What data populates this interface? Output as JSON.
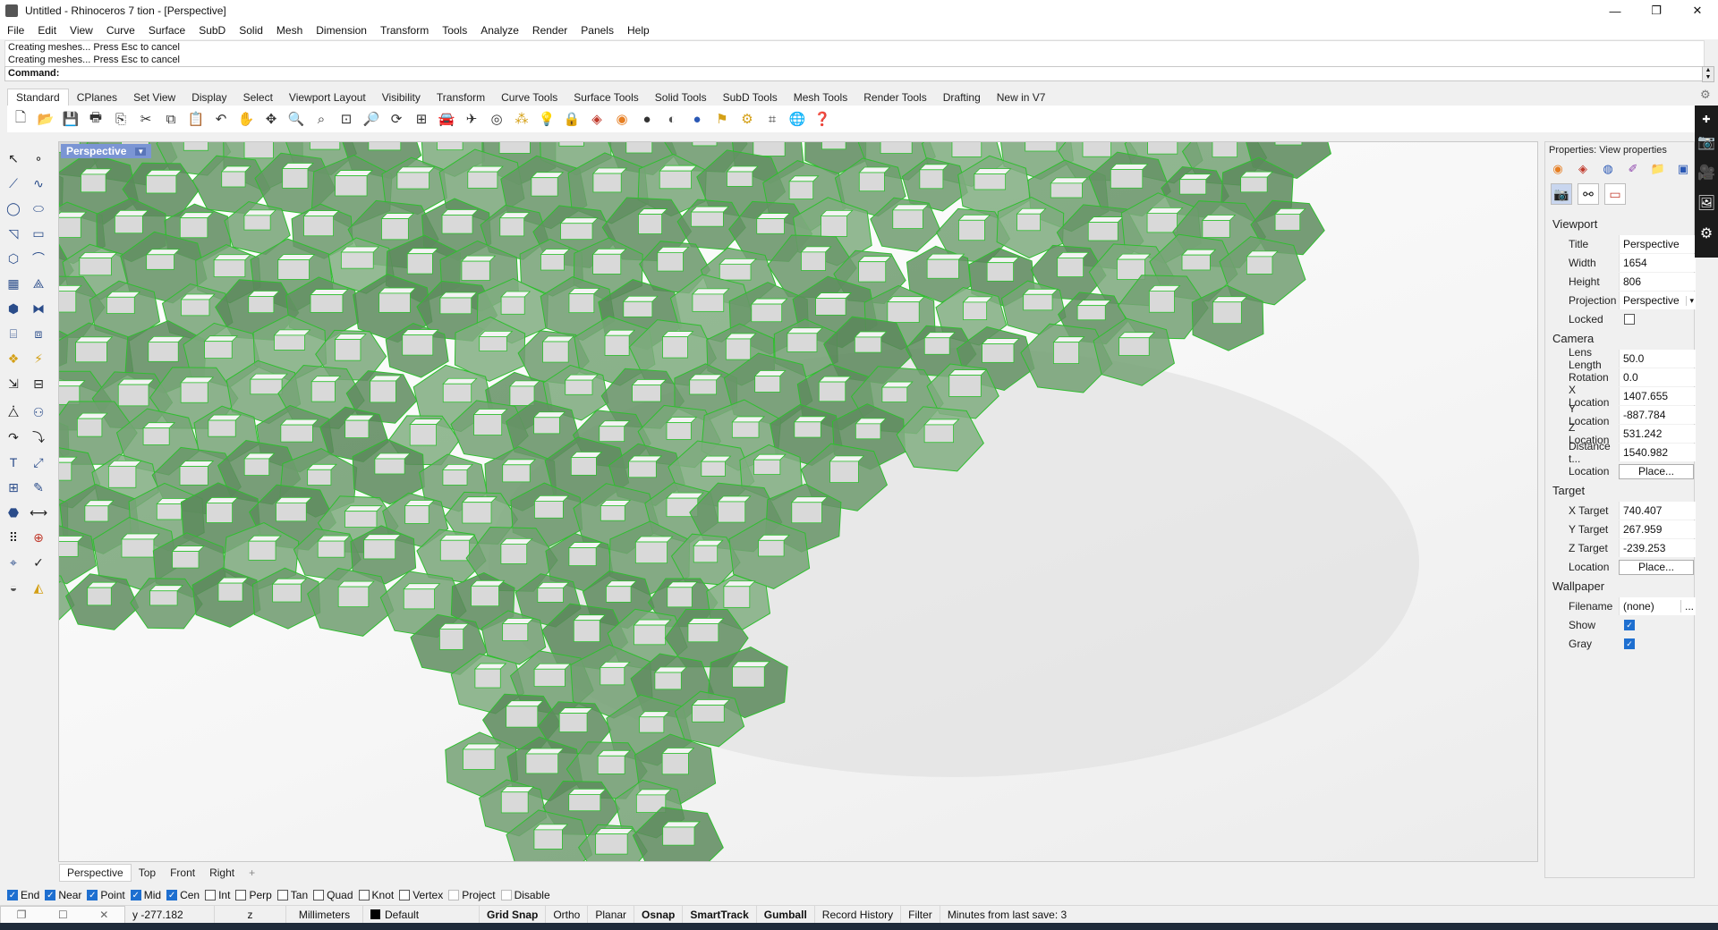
{
  "window": {
    "title": "Untitled - Rhinoceros 7 tion - [Perspective]",
    "minimize": "—",
    "maximize": "❐",
    "close": "✕"
  },
  "menu": [
    "File",
    "Edit",
    "View",
    "Curve",
    "Surface",
    "SubD",
    "Solid",
    "Mesh",
    "Dimension",
    "Transform",
    "Tools",
    "Analyze",
    "Render",
    "Panels",
    "Help"
  ],
  "command": {
    "history_1": "Creating meshes... Press Esc to cancel",
    "history_2": "Creating meshes... Press Esc to cancel",
    "prompt": "Command:"
  },
  "toolbar_tabs": [
    "Standard",
    "CPlanes",
    "Set View",
    "Display",
    "Select",
    "Viewport Layout",
    "Visibility",
    "Transform",
    "Curve Tools",
    "Surface Tools",
    "Solid Tools",
    "SubD Tools",
    "Mesh Tools",
    "Render Tools",
    "Drafting",
    "New in V7"
  ],
  "toolbar_icons": [
    "new-icon",
    "open-icon",
    "save-icon",
    "print-icon",
    "import-icon",
    "cut-icon",
    "copy-icon",
    "paste-icon",
    "undo-icon",
    "pan-icon",
    "rotate-icon",
    "zoom-icon",
    "zoom-window-icon",
    "zoom-extents-icon",
    "zoom-selected-icon",
    "rotate-view-icon",
    "four-viewports-icon",
    "car-icon",
    "plane-icon",
    "target-icon",
    "select-points-icon",
    "bulb-icon",
    "lock-icon",
    "material-icon",
    "color-wheel-icon",
    "sphere-shaded-icon",
    "sphere-render-icon",
    "sphere-blue-icon",
    "flag-icon",
    "gear-icon",
    "grid-icon",
    "globe-icon",
    "help-icon"
  ],
  "viewport": {
    "label": "Perspective",
    "tabs": [
      "Perspective",
      "Top",
      "Front",
      "Right"
    ],
    "add_tab": "+"
  },
  "osnap": [
    {
      "label": "End",
      "on": true
    },
    {
      "label": "Near",
      "on": true
    },
    {
      "label": "Point",
      "on": true
    },
    {
      "label": "Mid",
      "on": true
    },
    {
      "label": "Cen",
      "on": true
    },
    {
      "label": "Int",
      "on": false
    },
    {
      "label": "Perp",
      "on": false
    },
    {
      "label": "Tan",
      "on": false
    },
    {
      "label": "Quad",
      "on": false
    },
    {
      "label": "Knot",
      "on": false
    },
    {
      "label": "Vertex",
      "on": false
    },
    {
      "label": "Project",
      "on": false
    },
    {
      "label": "Disable",
      "on": false
    }
  ],
  "status": {
    "y": "y -277.182",
    "z": "z",
    "units": "Millimeters",
    "layer": "Default",
    "grid_snap": "Grid Snap",
    "ortho": "Ortho",
    "planar": "Planar",
    "osnap": "Osnap",
    "smarttrack": "SmartTrack",
    "gumball": "Gumball",
    "record_history": "Record History",
    "filter": "Filter",
    "last_save": "Minutes from last save: 3"
  },
  "properties": {
    "title": "Properties: View properties",
    "viewport_section": "Viewport",
    "title_label": "Title",
    "title_value": "Perspective",
    "width_label": "Width",
    "width_value": "1654",
    "height_label": "Height",
    "height_value": "806",
    "projection_label": "Projection",
    "projection_value": "Perspective",
    "locked_label": "Locked",
    "camera_section": "Camera",
    "lens_label": "Lens Length",
    "lens_value": "50.0",
    "rotation_label": "Rotation",
    "rotation_value": "0.0",
    "xloc_label": "X Location",
    "xloc_value": "1407.655",
    "yloc_label": "Y Location",
    "yloc_value": "-887.784",
    "zloc_label": "Z Location",
    "zloc_value": "531.242",
    "dist_label": "Distance t...",
    "dist_value": "1540.982",
    "loc_label": "Location",
    "place_label": "Place...",
    "target_section": "Target",
    "xt_label": "X Target",
    "xt_value": "740.407",
    "yt_label": "Y Target",
    "yt_value": "267.959",
    "zt_label": "Z Target",
    "zt_value": "-239.253",
    "tloc_label": "Location",
    "tplace_label": "Place...",
    "wallpaper_section": "Wallpaper",
    "file_label": "Filename",
    "file_value": "(none)",
    "file_btn": "...",
    "show_label": "Show",
    "gray_label": "Gray"
  }
}
